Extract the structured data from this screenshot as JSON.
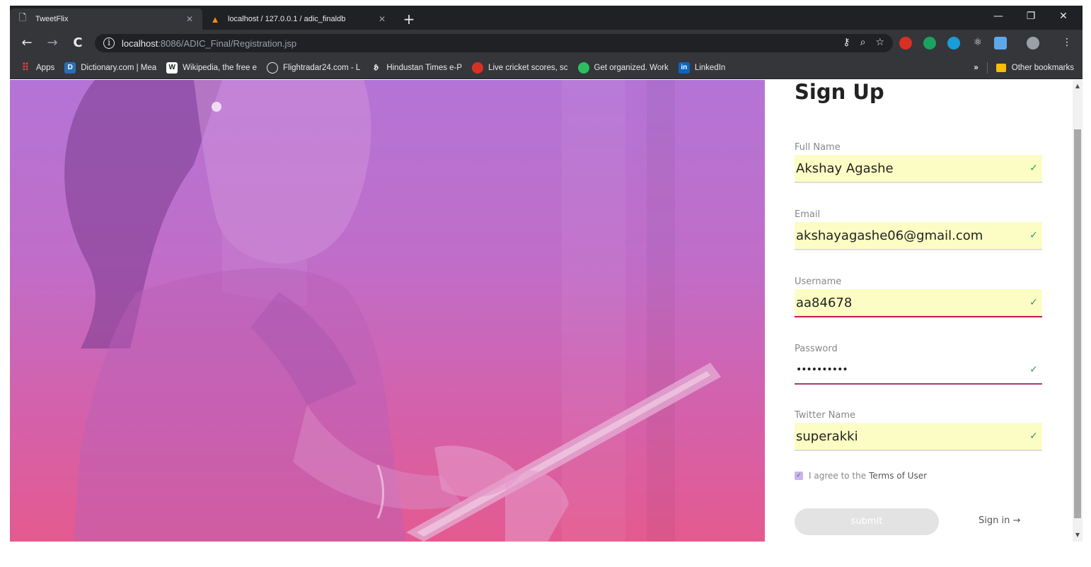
{
  "browser": {
    "tabs": [
      {
        "title": "TweetFlix",
        "active": true
      },
      {
        "title": "localhost / 127.0.0.1 / adic_finaldb",
        "active": false
      }
    ],
    "new_tab": "+",
    "window_controls": {
      "minimize": "—",
      "restore": "❐",
      "close": "✕"
    },
    "nav": {
      "back": "←",
      "forward": "→",
      "reload": "C"
    },
    "url_host": "localhost",
    "url_rest": ":8086/ADIC_Final/Registration.jsp",
    "bookmarks": [
      {
        "label": "Apps",
        "icon": "apps-grid-icon",
        "color": "#4285f4"
      },
      {
        "label": "Dictionary.com | Mea",
        "icon": "dictionary-icon",
        "color": "#2a6eb8"
      },
      {
        "label": "Wikipedia, the free e",
        "icon": "wikipedia-icon",
        "color": "#ffffff"
      },
      {
        "label": "Flightradar24.com - L",
        "icon": "flightradar-icon",
        "color": "#9aa0a6"
      },
      {
        "label": "Hindustan Times e-P",
        "icon": "hindustan-times-icon",
        "color": "#ffffff"
      },
      {
        "label": "Live cricket scores, sc",
        "icon": "cricket-icon",
        "color": "#d93025"
      },
      {
        "label": "Get organized. Work",
        "icon": "evernote-icon",
        "color": "#2dbe60"
      },
      {
        "label": "LinkedIn",
        "icon": "linkedin-icon",
        "color": "#0a66c2"
      }
    ],
    "bookmarks_more": "»",
    "other_bookmarks": "Other bookmarks"
  },
  "form": {
    "title": "Sign Up",
    "fields": [
      {
        "label": "Full Name",
        "value": "Akshay Agashe"
      },
      {
        "label": "Email",
        "value": "akshayagashe06@gmail.com"
      },
      {
        "label": "Username",
        "value": "aa84678"
      },
      {
        "label": "Password",
        "value": "••••••••••"
      },
      {
        "label": "Twitter Name",
        "value": "superakki"
      }
    ],
    "agree_text": "I agree to the",
    "terms_text": "Terms of User",
    "agree_checked": true,
    "submit": "submit",
    "signin": "Sign in →"
  },
  "colors": {
    "field_bg": "#fcfdc4",
    "check": "#2e9e5b",
    "hero_top": "#b474d6",
    "hero_bottom": "#e45a90"
  }
}
